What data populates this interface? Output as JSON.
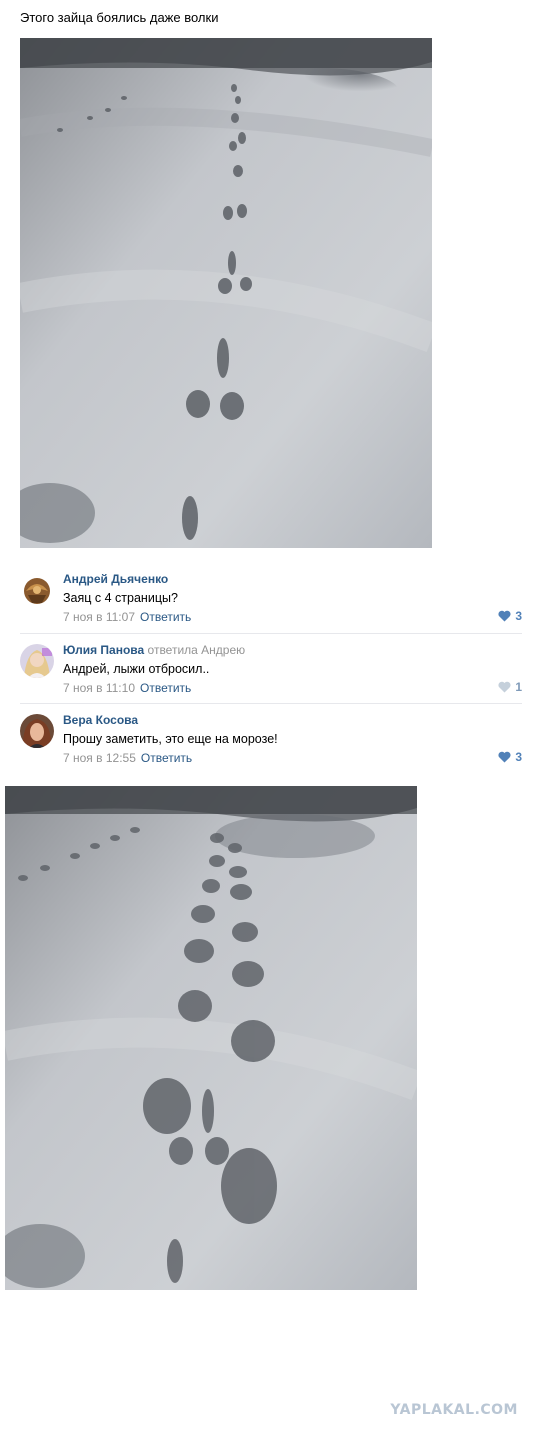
{
  "post": {
    "text": "Этого зайца боялись даже волки"
  },
  "comments": [
    {
      "author": "Андрей Дьяченко",
      "reply_prefix": "",
      "reply_name": "",
      "text": "Заяц с 4 страницы?",
      "date": "7 ноя в 11:07",
      "reply_label": "Ответить",
      "likes": "3"
    },
    {
      "author": "Юлия Панова",
      "reply_prefix": "ответила",
      "reply_name": "Андрею",
      "text": "Андрей, лыжи отбросил..",
      "date": "7 ноя в 11:10",
      "reply_label": "Ответить",
      "likes": "1"
    },
    {
      "author": "Вера Косова",
      "reply_prefix": "",
      "reply_name": "",
      "text": "Прошу заметить, это еще на морозе!",
      "date": "7 ноя в 12:55",
      "reply_label": "Ответить",
      "likes": "3"
    }
  ],
  "watermark": "YAPLAKAL.COM",
  "colors": {
    "link": "#2a5885",
    "meta": "#939393",
    "like_active": "#5181b8",
    "like_inactive": "#7f9ab8",
    "snow": "#c9ccd2"
  }
}
